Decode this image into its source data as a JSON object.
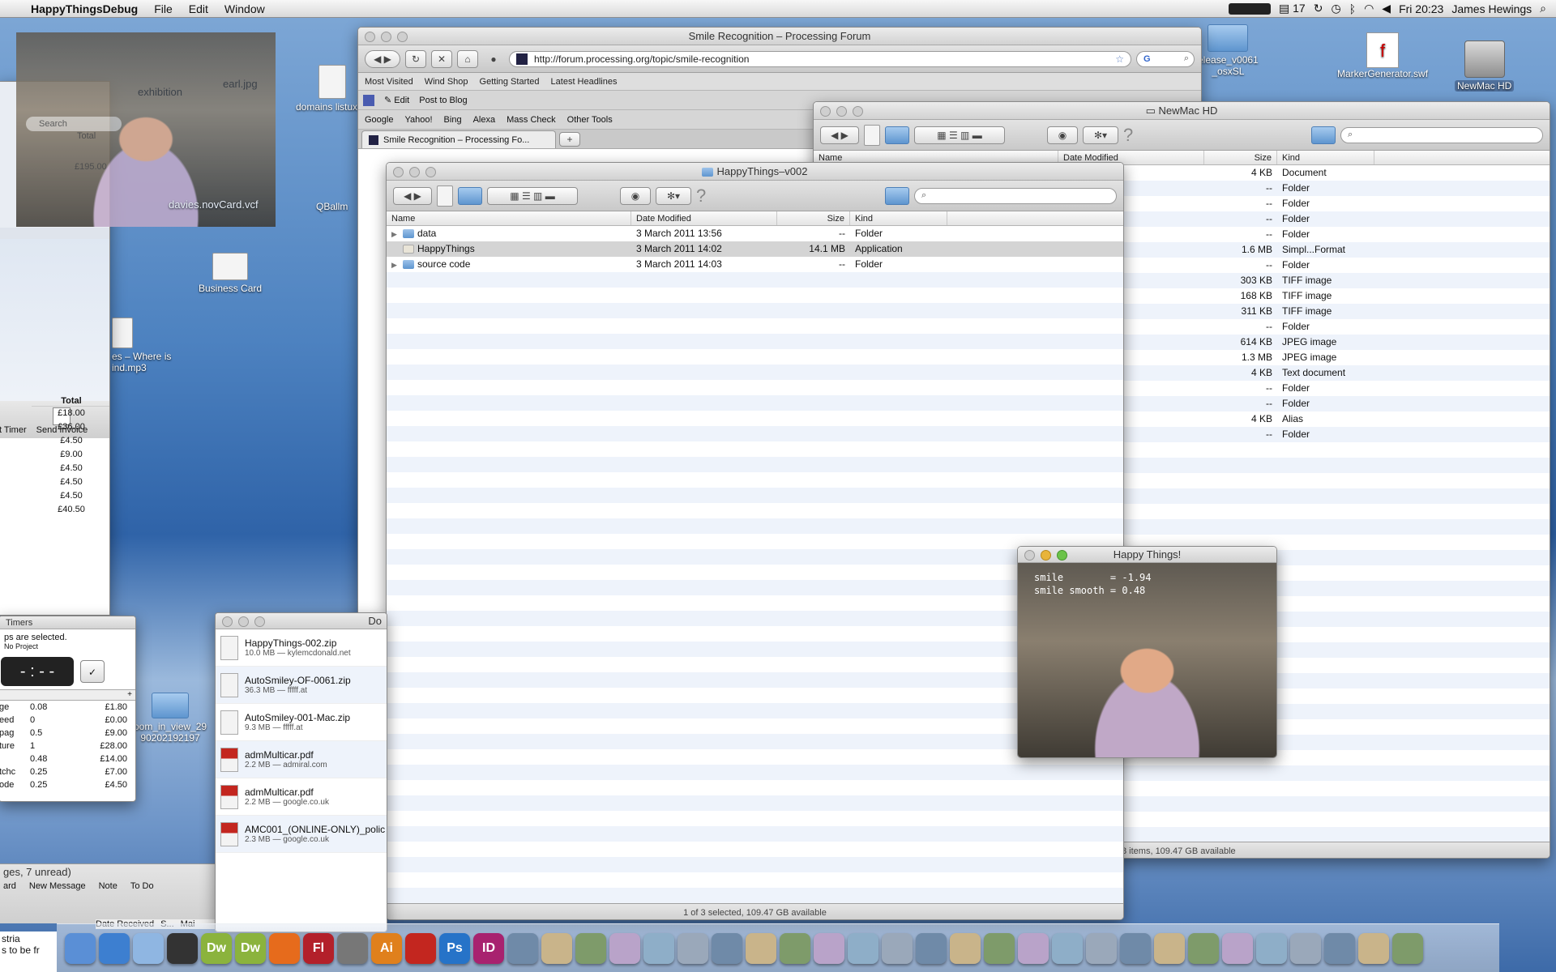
{
  "menubar": {
    "app": "HappyThingsDebug",
    "menus": [
      "File",
      "Edit",
      "Window"
    ],
    "calendar_day": "17",
    "clock": "Fri 20:23",
    "user": "James Hewings"
  },
  "desktop_icons": {
    "earl": "earl.jpg",
    "exhibition": "exhibition",
    "domains": "domains listuxlsx",
    "davies": "davies.novCard.vcf",
    "qballm": "QBallm",
    "business_card": "Business Card",
    "where_is": "es – Where is",
    "mind_mp3": "ind.mp3",
    "release": "elease_v0061",
    "osxsl": "_osxSL",
    "marker": "MarkerGenerator.swf",
    "hd": "NewMac HD",
    "boom": "oom_in_view_29",
    "boom2": "90202192197"
  },
  "browser": {
    "title": "Smile Recognition – Processing Forum",
    "url": "http://forum.processing.org/topic/smile-recognition",
    "bookmarks": [
      "Most Visited",
      "Wind Shop",
      "Getting Started",
      "Latest Headlines"
    ],
    "toolbar2": {
      "edit": "Edit",
      "post": "Post to Blog"
    },
    "searches": [
      "Google",
      "Yahoo!",
      "Bing",
      "Alexa",
      "Mass Check",
      "Other Tools"
    ],
    "tab": "Smile Recognition – Processing Fo..."
  },
  "finder_v002": {
    "title": "HappyThings–v002",
    "columns": {
      "name": "Name",
      "date": "Date Modified",
      "size": "Size",
      "kind": "Kind"
    },
    "rows": [
      {
        "name": "data",
        "date": "3 March 2011 13:56",
        "size": "--",
        "kind": "Folder"
      },
      {
        "name": "HappyThings",
        "date": "3 March 2011 14:02",
        "size": "14.1 MB",
        "kind": "Application"
      },
      {
        "name": "source code",
        "date": "3 March 2011 14:03",
        "size": "--",
        "kind": "Folder"
      }
    ],
    "status": "1 of 3 selected, 109.47 GB available"
  },
  "finder_hd": {
    "title": "NewMac HD",
    "columns": {
      "name": "Name",
      "date": "Date Modified",
      "size": "Size",
      "kind": "Kind"
    },
    "rows": [
      {
        "date": ")09 09:46",
        "size": "4 KB",
        "kind": "Document"
      },
      {
        "date": "2010 21:46",
        "size": "--",
        "kind": "Folder"
      },
      {
        "date": "1 13:09",
        "size": "--",
        "kind": "Folder"
      },
      {
        "date": "1 15:38",
        "size": "--",
        "kind": "Folder"
      },
      {
        "date": "1 14:05",
        "size": "--",
        "kind": "Folder"
      },
      {
        "date": "10 18:38",
        "size": "1.6 MB",
        "kind": "Simpl...Format"
      },
      {
        "date": "2010 01:00",
        "size": "--",
        "kind": "Folder"
      },
      {
        "date": "1 12:11",
        "size": "303 KB",
        "kind": "TIFF image"
      },
      {
        "date": "1 12:12",
        "size": "168 KB",
        "kind": "TIFF image"
      },
      {
        "date": "1 12:29",
        "size": "311 KB",
        "kind": "TIFF image"
      },
      {
        "date": "2010 17:42",
        "size": "--",
        "kind": "Folder"
      },
      {
        "date": "2010 19:02",
        "size": "614 KB",
        "kind": "JPEG image"
      },
      {
        "date": "2010 19:22",
        "size": "1.3 MB",
        "kind": "JPEG image"
      },
      {
        "date": "09 12:38",
        "size": "4 KB",
        "kind": "Text document"
      },
      {
        "date": "2011 22:16",
        "size": "--",
        "kind": "Folder"
      },
      {
        "date": "09 16:36",
        "size": "--",
        "kind": "Folder"
      },
      {
        "date": "08 22:54",
        "size": "4 KB",
        "kind": "Alias"
      },
      {
        "date": "2009 10:40",
        "size": "--",
        "kind": "Folder"
      }
    ],
    "status": "8 items, 109.47 GB available"
  },
  "happy": {
    "title": "Happy Things!",
    "line1": "smile        = -1.94",
    "line2": "smile smooth = 0.48"
  },
  "invoice": {
    "timer": "t Timer",
    "send": "Send Invoice",
    "total_header": "Total",
    "totals": [
      "£18.00",
      "£36.00",
      "£4.50",
      "£9.00",
      "£4.50",
      "£4.50",
      "£4.50",
      "£40.50"
    ]
  },
  "timers": {
    "title": "Timers",
    "msg1": "ps are selected.",
    "msg2": "No Project",
    "rows": [
      {
        "label": "ge",
        "val": "0.08",
        "amt": "£1.80"
      },
      {
        "label": "eed",
        "val": "0",
        "amt": "£0.00"
      },
      {
        "label": "pag",
        "val": "0.5",
        "amt": "£9.00"
      },
      {
        "label": "ture",
        "val": "1",
        "amt": "£28.00"
      },
      {
        "label": "",
        "val": "0.48",
        "amt": "£14.00"
      },
      {
        "label": "tchc",
        "val": "0.25",
        "amt": "£7.00"
      },
      {
        "label": "ode",
        "val": "0.25",
        "amt": "£4.50"
      }
    ]
  },
  "top_left_panel": {
    "search": "Search",
    "total": "Total",
    "amount": "£195.00"
  },
  "downloads": {
    "title": "Do",
    "items": [
      {
        "name": "HappyThings-002.zip",
        "meta": "10.0 MB — kylemcdonald.net",
        "type": "ZIP"
      },
      {
        "name": "AutoSmiley-OF-0061.zip",
        "meta": "36.3 MB — fffff.at",
        "type": "ZIP"
      },
      {
        "name": "AutoSmiley-001-Mac.zip",
        "meta": "9.3 MB — fffff.at",
        "type": "ZIP"
      },
      {
        "name": "admMulticar.pdf",
        "meta": "2.2 MB — admiral.com",
        "type": "PDF"
      },
      {
        "name": "admMulticar.pdf",
        "meta": "2.2 MB — google.co.uk",
        "type": "PDF"
      },
      {
        "name": "AMC001_(ONLINE-ONLY)_polic",
        "meta": "2.3 MB — google.co.uk",
        "type": "PDF"
      }
    ]
  },
  "mail": {
    "count": "ges, 7 unread)",
    "board": "ard",
    "new_message": "New Message",
    "note": "Note",
    "todo": "To Do",
    "date_received": "Date Received",
    "s": "S...",
    "mai": "Mai",
    "line1": "stria",
    "line2": "s to be fr"
  },
  "dock": [
    "Dw",
    "Dw",
    "Fl",
    "Ai",
    "Ps",
    "ID"
  ],
  "colors": {
    "selection": "#d4d4d4",
    "stripe": "#eef3fb"
  }
}
